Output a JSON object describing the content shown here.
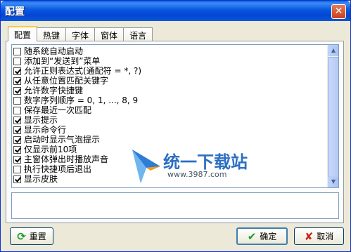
{
  "window": {
    "title": "配置"
  },
  "tabs": [
    {
      "label": "配置"
    },
    {
      "label": "热键"
    },
    {
      "label": "字体"
    },
    {
      "label": "窗体"
    },
    {
      "label": "语言"
    }
  ],
  "options": [
    {
      "label": "随系统自动启动",
      "checked": false
    },
    {
      "label": "添加到“发送到”菜单",
      "checked": false
    },
    {
      "label": "允许正则表达式(通配符 = *, ?)",
      "checked": true
    },
    {
      "label": "从任意位置匹配关键字",
      "checked": true
    },
    {
      "label": "允许数字快捷键",
      "checked": true
    },
    {
      "label": "数字序列顺序 = 0, 1, ..., 8, 9",
      "checked": false
    },
    {
      "label": "保存最近一次匹配",
      "checked": false
    },
    {
      "label": "显示提示",
      "checked": true
    },
    {
      "label": "显示命令行",
      "checked": true
    },
    {
      "label": "启动时显示气泡提示",
      "checked": true
    },
    {
      "label": "仅显示前10项",
      "checked": true
    },
    {
      "label": "主窗体弹出时播放声音",
      "checked": true
    },
    {
      "label": "执行快捷项后退出",
      "checked": false
    },
    {
      "label": "显示皮肤",
      "checked": true
    }
  ],
  "watermark": {
    "text": "统一下载站",
    "url": "www.3987.com"
  },
  "buttons": {
    "reset": {
      "label": "重置",
      "icon": "refresh-icon"
    },
    "ok": {
      "label": "确定",
      "icon": "check-icon"
    },
    "cancel": {
      "label": "取消",
      "icon": "x-icon"
    }
  },
  "colors": {
    "title_bar": "#0a57d8",
    "tab_highlight": "#ffc83c",
    "ok_icon": "#1a9d2a",
    "cancel_icon": "#c8241c"
  }
}
